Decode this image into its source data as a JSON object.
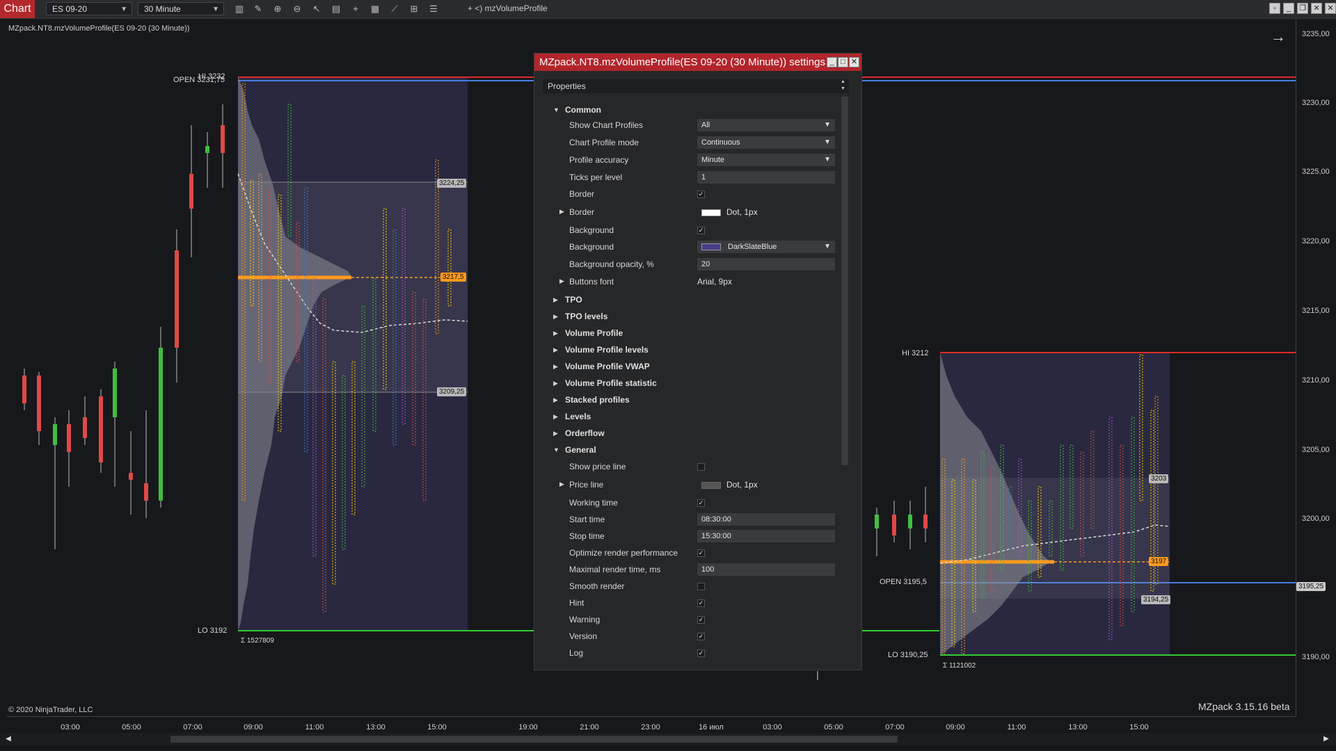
{
  "toolbar": {
    "chart_tab": "Chart",
    "instrument": "ES 09-20",
    "interval": "30 Minute",
    "indicator_name": "+ <) mzVolumeProfile"
  },
  "chart": {
    "label": "MZpack.NT8.mzVolumeProfile(ES 09-20 (30 Minute))",
    "copyright": "© 2020 NinjaTrader, LLC",
    "version": "MZpack 3.15.16 beta",
    "price_ticks": [
      "3235,00",
      "3230,00",
      "3225,00",
      "3220,00",
      "3215,00",
      "3210,00",
      "3205,00",
      "3200,00",
      "3195,25",
      "3190,00"
    ],
    "time_ticks": [
      "03:00",
      "05:00",
      "07:00",
      "09:00",
      "11:00",
      "13:00",
      "15:00",
      "19:00",
      "21:00",
      "23:00",
      "16 июл",
      "03:00",
      "05:00",
      "07:00",
      "09:00",
      "11:00",
      "13:00",
      "15:00"
    ],
    "left_profile": {
      "open_label": "OPEN 3231,75",
      "hi_label": "HI 3232",
      "lo_label": "LO 3192",
      "sum_label": "Σ 1527809",
      "tag_high": "3224,25",
      "tag_poc": "3217,5",
      "tag_low": "3209,25"
    },
    "right_profile": {
      "hi_label": "HI 3212",
      "open_label": "OPEN 3195,5",
      "lo_label": "LO 3190,25",
      "sum_label": "Σ 1121002",
      "tag_high": "3203",
      "tag_poc": "3197",
      "tag_low": "3194,25",
      "price_tag": "3195,25"
    },
    "colors": {
      "profile_bg": "#2d2b47",
      "poc": "#ff9a1f",
      "up_candle": "#3fbf3f",
      "down_candle": "#e04848",
      "hi_line": "#e02a2a",
      "lo_line": "#32cd32",
      "open_line": "#4a7de0"
    }
  },
  "dialog": {
    "title": "MZpack.NT8.mzVolumeProfile(ES 09-20 (30 Minute)) settings",
    "properties_label": "Properties",
    "common": {
      "label": "Common",
      "rows": [
        {
          "label": "Show Chart Profiles",
          "type": "select",
          "value": "All"
        },
        {
          "label": "Chart Profile mode",
          "type": "select",
          "value": "Continuous"
        },
        {
          "label": "Profile accuracy",
          "type": "select",
          "value": "Minute"
        },
        {
          "label": "Ticks per level",
          "type": "input",
          "value": "1"
        },
        {
          "label": "Border",
          "type": "check",
          "value": "✓"
        },
        {
          "label": "Border",
          "type": "stroke",
          "value": "Dot, 1px",
          "swatch": "#ffffff",
          "expand": true
        },
        {
          "label": "Background",
          "type": "check",
          "value": "✓"
        },
        {
          "label": "Background",
          "type": "colorselect",
          "value": "DarkSlateBlue",
          "swatch": "#483d8b"
        },
        {
          "label": "Background opacity, %",
          "type": "input",
          "value": "20"
        },
        {
          "label": "Buttons font",
          "type": "text",
          "value": "Arial, 9px",
          "expand": true
        }
      ]
    },
    "categories": [
      "TPO",
      "TPO levels",
      "Volume Profile",
      "Volume Profile levels",
      "Volume Profile VWAP",
      "Volume Profile statistic",
      "Stacked profiles",
      "Levels",
      "Orderflow"
    ],
    "general": {
      "label": "General",
      "rows": [
        {
          "label": "Show price line",
          "type": "check",
          "value": ""
        },
        {
          "label": "Price line",
          "type": "stroke",
          "value": "Dot, 1px",
          "swatch": "#555555",
          "expand": true
        },
        {
          "label": "Working time",
          "type": "check",
          "value": "✓"
        },
        {
          "label": "Start time",
          "type": "input",
          "value": "08:30:00"
        },
        {
          "label": "Stop time",
          "type": "input",
          "value": "15:30:00"
        },
        {
          "label": "Optimize render performance",
          "type": "check",
          "value": "✓"
        },
        {
          "label": "Maximal render time, ms",
          "type": "input",
          "value": "100"
        },
        {
          "label": "Smooth render",
          "type": "check",
          "value": ""
        },
        {
          "label": "Hint",
          "type": "check",
          "value": "✓"
        },
        {
          "label": "Warning",
          "type": "check",
          "value": "✓"
        },
        {
          "label": "Version",
          "type": "check",
          "value": "✓"
        },
        {
          "label": "Log",
          "type": "check",
          "value": "✓"
        }
      ]
    }
  }
}
